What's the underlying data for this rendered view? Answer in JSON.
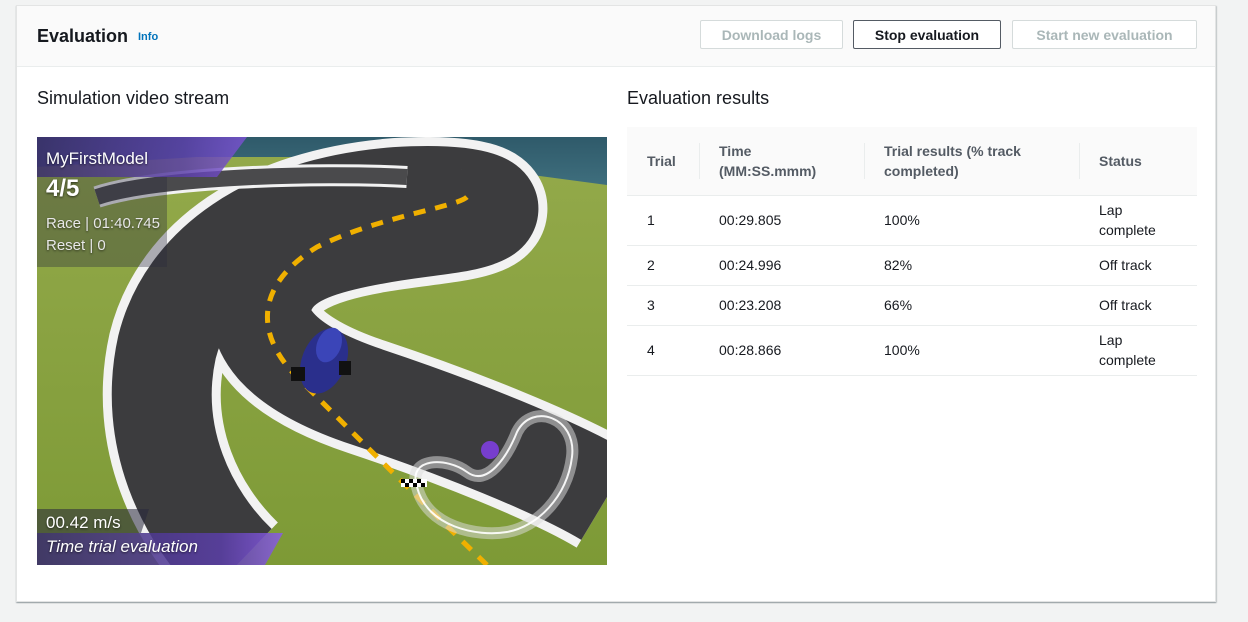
{
  "header": {
    "title": "Evaluation",
    "info_label": "Info",
    "buttons": {
      "download_logs": "Download logs",
      "stop_evaluation": "Stop evaluation",
      "start_new_evaluation": "Start new evaluation"
    }
  },
  "simulation": {
    "heading": "Simulation video stream",
    "overlay": {
      "model_name": "MyFirstModel",
      "trial_progress": "4/5",
      "race_time": "Race | 01:40.745",
      "reset_count": "Reset | 0",
      "speed": "00.42 m/s",
      "mode": "Time trial evaluation"
    }
  },
  "results": {
    "heading": "Evaluation results",
    "columns": [
      "Trial",
      "Time (MM:SS.mmm)",
      "Trial results (% track completed)",
      "Status"
    ],
    "rows": [
      {
        "trial": "1",
        "time": "00:29.805",
        "percent": "100%",
        "status": "Lap complete"
      },
      {
        "trial": "2",
        "time": "00:24.996",
        "percent": "82%",
        "status": "Off track"
      },
      {
        "trial": "3",
        "time": "00:23.208",
        "percent": "66%",
        "status": "Off track"
      },
      {
        "trial": "4",
        "time": "00:28.866",
        "percent": "100%",
        "status": "Lap complete"
      }
    ]
  },
  "colors": {
    "link": "#0073bb",
    "disabled_text": "#aab7b8",
    "grass": "#8aa83e",
    "track": "#3b3b3d",
    "center_line": "#f0b000",
    "car": "#2a2f8c",
    "overlay_purple": "#6a4bbd"
  },
  "icons": {
    "car": "race-car-icon",
    "minimap": "track-minimap-icon",
    "finish": "checkered-flag-icon"
  }
}
